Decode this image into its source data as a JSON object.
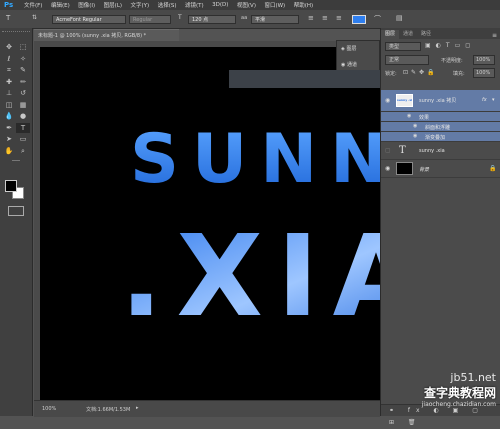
{
  "app": {
    "logo": "Ps"
  },
  "menu": [
    "文件(F)",
    "编辑(E)",
    "图像(I)",
    "图层(L)",
    "文字(Y)",
    "选择(S)",
    "滤镜(T)",
    "3D(D)",
    "视图(V)",
    "窗口(W)",
    "帮助(H)"
  ],
  "options": {
    "font_family": "AcmeFont Regular",
    "font_style": "Regular",
    "font_size": "120 点",
    "antialias": "平滑"
  },
  "document": {
    "tab_title": "未标题-1 @ 100% (sunny .xia 拷贝, RGB/8) *",
    "zoom": "100%",
    "doc_size": "文档:1.66M/1.53M"
  },
  "canvas_text": {
    "line1": "SUNNY",
    "line2": ".XIA"
  },
  "panel_strip": [
    "图层",
    "通道"
  ],
  "layers_panel": {
    "tabs": [
      "图层",
      "通道",
      "路径"
    ],
    "kind_label": "类型",
    "blend_mode": "正常",
    "opacity_label": "不透明度:",
    "opacity_value": "100%",
    "lock_label": "锁定:",
    "fill_label": "填充:",
    "fill_value": "100%",
    "layers": [
      {
        "name": "sunny .xia 拷贝",
        "type": "text",
        "fx": "fx",
        "thumb_text": "sunny .xia"
      },
      {
        "name": "sunny .xia",
        "type": "text"
      },
      {
        "name": "背景",
        "type": "background"
      }
    ],
    "effects_label": "效果",
    "effects": [
      "斜面和浮雕",
      "渐变叠加"
    ]
  },
  "watermark": {
    "line1": "jb51.net",
    "line2": "查字典教程网",
    "line3": "jiaocheng.chazidian.com"
  },
  "colors": {
    "accent": "#2f7fef",
    "canvas_bg": "#000000",
    "text_blue": "#3a8cf0"
  }
}
